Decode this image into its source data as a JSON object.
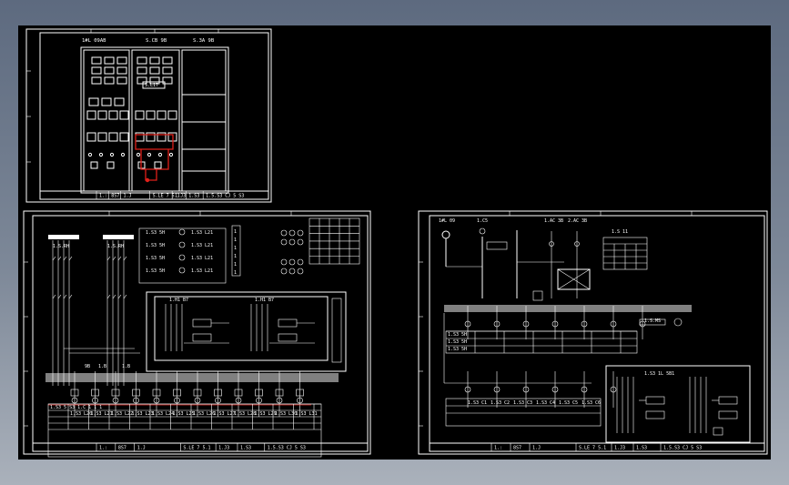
{
  "sheet_a": {
    "panel_headers": [
      "1#L 09AB",
      "S.CB 9B",
      "S.3A 9B"
    ],
    "panel_tag": "S.L17",
    "title_block": [
      "1.:",
      "8S7",
      "1.J",
      "S.LE 7 5.1",
      "1.J3",
      "1.S3",
      "1.5.S3 CJ 5 S3"
    ]
  },
  "sheet_b": {
    "source_tags": [
      "1.S.RH",
      "1.S.RH"
    ],
    "meter_rows": [
      {
        "tag": "1.S3 5H",
        "code": "1.S3 L21"
      },
      {
        "tag": "1.S3 5H",
        "code": "1.S3 L21"
      },
      {
        "tag": "1.S3 5H",
        "code": "1.S3 L21"
      },
      {
        "tag": "1.S3 5H",
        "code": "1.S3 L21"
      }
    ],
    "relay_labels": [
      "1.H1 B7",
      "1.H1 B7"
    ],
    "bus_tags": [
      "9B",
      "1.B",
      "1.B"
    ],
    "feeder_codes": [
      "1.S3 L20",
      "1.S3 L21",
      "1.S3 L22",
      "1.S3 L23",
      "1.S3 L24",
      "1.S3 L25",
      "1.S3 L26",
      "1.S3 L27",
      "1.S3 L28",
      "1.S3 L29",
      "1.S3 L30",
      "1.S3 L31"
    ],
    "table_header": "1.S3 5 S3 1.C 1 1 1",
    "title_block": [
      "1.:",
      "8S7",
      "1.J",
      "S.LE 7 5.1",
      "1.J3",
      "1.S3",
      "1.5.S3 CJ 5 S3"
    ]
  },
  "sheet_c": {
    "top_tags": [
      "1#L 09",
      "1.C5",
      "1.AC 3B",
      "2.AC 3B",
      "1.S 11"
    ],
    "bus_tag": "1.S.MS",
    "table_rows": [
      "1.S3 5H",
      "1.S3 5H",
      "1.S3 5H"
    ],
    "feeder_codes": [
      "1.S3 C1",
      "1.S3 C2",
      "1.S3 C3",
      "1.S3 C4",
      "1.S3 C5",
      "1.S3 C6"
    ],
    "inset_header": "1.S3 1L 5B1",
    "title_block": [
      "1.:",
      "8S7",
      "1.J",
      "S.LE 7 5.1",
      "1.J3",
      "1.S3",
      "1.5.S3 CJ 5 S3"
    ]
  }
}
